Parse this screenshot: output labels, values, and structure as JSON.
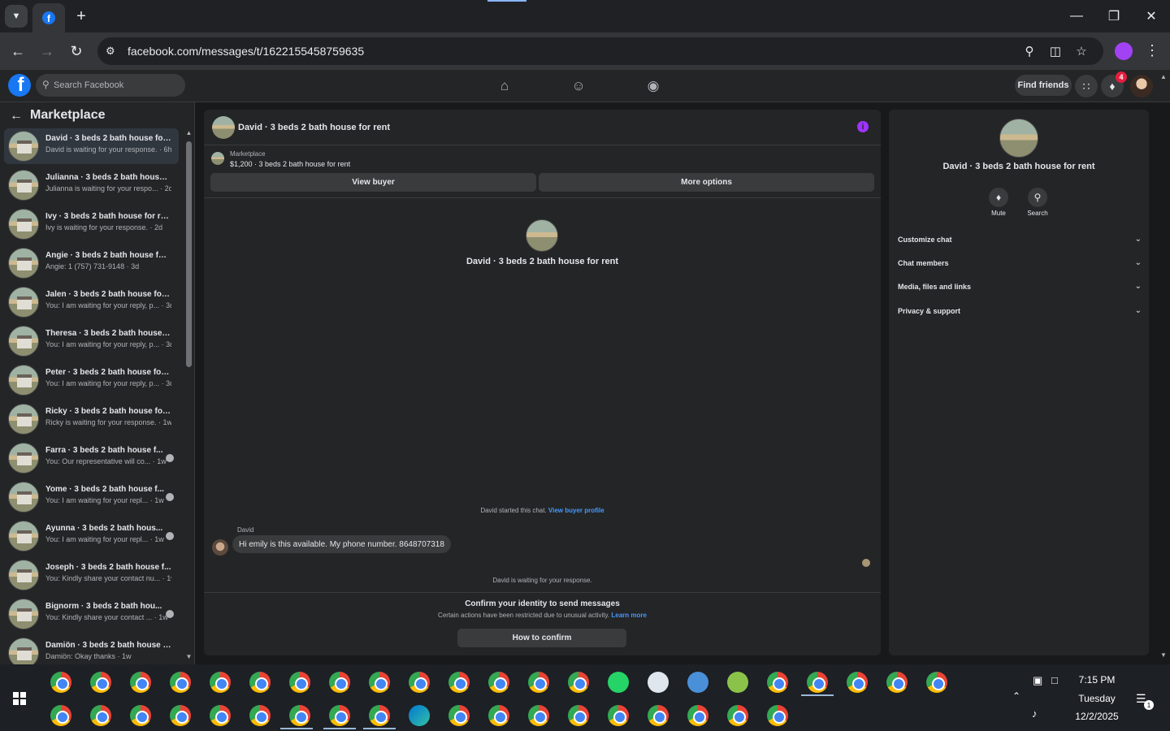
{
  "browser": {
    "url": "facebook.com/messages/t/1622155458759635",
    "new_tab_symbol": "+",
    "icons": [
      "tab-list-icon",
      "facebook-icon",
      "plus-icon",
      "minimize-icon",
      "restore-icon",
      "close-icon",
      "back-icon",
      "forward-icon",
      "reload-icon",
      "site-info-icon",
      "zoom-icon",
      "install-icon",
      "star-icon",
      "profile-icon",
      "more-vert-icon"
    ]
  },
  "fb_header": {
    "search_placeholder": "Search Facebook",
    "find_friends": "Find friends",
    "notification_count": "4"
  },
  "sidebar": {
    "title": "Marketplace",
    "conversations": [
      {
        "name": "David · 3 beds 2 bath house for...",
        "sub": "David is waiting for your response. · 6h",
        "active": true
      },
      {
        "name": "Julianna · 3 beds 2 bath house ...",
        "sub": "Julianna is waiting for your respo... · 2d"
      },
      {
        "name": "Ivy · 3 beds 2 bath house for rent",
        "sub": "Ivy is waiting for your response. · 2d"
      },
      {
        "name": "Angie · 3 beds 2 bath house for...",
        "sub": "Angie: 1 (757) 731-9148 · 3d"
      },
      {
        "name": "Jalen · 3 beds 2 bath house for ...",
        "sub": "You: I am waiting for your reply, p... · 3d"
      },
      {
        "name": "Theresa · 3 beds 2 bath house f...",
        "sub": "You: I am waiting for your reply, p... · 3d"
      },
      {
        "name": "Peter · 3 beds 2 bath house for ...",
        "sub": "You: I am waiting for your reply, p... · 3d"
      },
      {
        "name": "Ricky · 3 beds 2 bath house for ...",
        "sub": "Ricky is waiting for your response. · 1w"
      },
      {
        "name": "Farra · 3 beds 2 bath house f...",
        "sub": "You: Our representative will co... · 1w"
      },
      {
        "name": "Yome · 3 beds 2 bath house f...",
        "sub": "You: I am waiting for your repl... · 1w"
      },
      {
        "name": "Ayunna · 3 beds 2 bath hous...",
        "sub": "You: I am waiting for your repl... · 1w"
      },
      {
        "name": "Joseph · 3 beds 2 bath house f...",
        "sub": "You: Kindly share your contact nu... · 1w"
      },
      {
        "name": "Bignorm · 3 beds 2 bath hou...",
        "sub": "You: Kindly share your contact ... · 1w"
      },
      {
        "name": "Damiön · 3 beds 2 bath house f...",
        "sub": "Damiön: Okay thanks · 1w"
      }
    ]
  },
  "chat": {
    "header_title": "David · 3 beds 2 bath house for rent",
    "marketplace_label": "Marketplace",
    "marketplace_item": "$1,200 · 3 beds 2 bath house for rent",
    "view_buyer": "View buyer",
    "more_options": "More options",
    "center_title": "David · 3 beds 2 bath house for rent",
    "started_text": "David started this chat.",
    "started_link": "View buyer profile",
    "message_sender": "David",
    "message_text": "Hi emily is this available. My phone number.  8648707318",
    "waiting_text": "David is waiting for your response.",
    "confirm_title": "Confirm your identity to send messages",
    "confirm_sub": "Certain actions have been restricted due to unusual activity.",
    "learn_more": "Learn more",
    "how_to_confirm": "How to confirm"
  },
  "right_panel": {
    "title": "David · 3 beds 2 bath house for rent",
    "mute": "Mute",
    "search": "Search",
    "sections": [
      "Customize chat",
      "Chat members",
      "Media, files and links",
      "Privacy & support"
    ]
  },
  "taskbar": {
    "time": "7:15 PM",
    "day": "Tuesday",
    "date": "12/2/2025",
    "notification_count": "1"
  }
}
